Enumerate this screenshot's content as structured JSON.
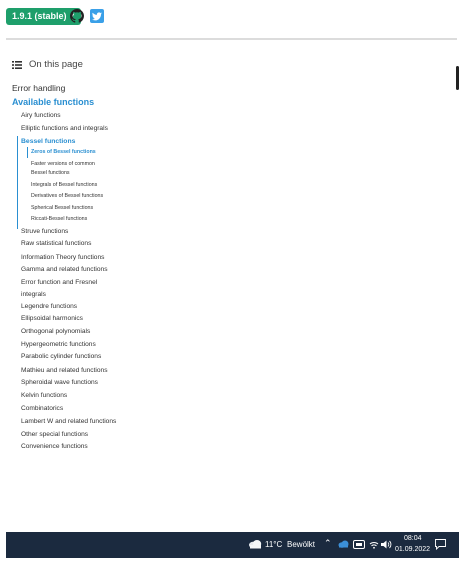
{
  "header": {
    "version_label": "1.9.1 (stable)",
    "github_icon": "github-icon",
    "twitter_icon": "twitter-icon"
  },
  "sidebar": {
    "on_this_page": "On this page",
    "items": [
      {
        "label": "Error handling",
        "level": 0
      },
      {
        "label": "Available functions",
        "level": 0,
        "active": true
      },
      {
        "label": "Airy functions",
        "level": 1
      },
      {
        "label": "Elliptic functions and integrals",
        "level": 1
      },
      {
        "label": "Bessel functions",
        "level": 1,
        "active": true
      },
      {
        "label": "Zeros of Bessel functions",
        "level": 2,
        "active": true
      },
      {
        "label": "Faster versions of common",
        "level": 2
      },
      {
        "label": "Bessel functions",
        "level": 2
      },
      {
        "label": "Integrals of Bessel functions",
        "level": 2
      },
      {
        "label": "Derivatives of Bessel functions",
        "level": 2
      },
      {
        "label": "Spherical Bessel functions",
        "level": 2
      },
      {
        "label": "Riccati-Bessel functions",
        "level": 2
      },
      {
        "label": "Struve functions",
        "level": 1
      },
      {
        "label": "Raw statistical functions",
        "level": 1
      },
      {
        "label": "Information Theory functions",
        "level": 1
      },
      {
        "label": "Gamma and related functions",
        "level": 1
      },
      {
        "label": "Error function and Fresnel",
        "level": 1
      },
      {
        "label": "integrals",
        "level": 1
      },
      {
        "label": "Legendre functions",
        "level": 1
      },
      {
        "label": "Ellipsoidal harmonics",
        "level": 1
      },
      {
        "label": "Orthogonal polynomials",
        "level": 1
      },
      {
        "label": "Hypergeometric functions",
        "level": 1
      },
      {
        "label": "Parabolic cylinder functions",
        "level": 1
      },
      {
        "label": "Mathieu and related functions",
        "level": 1
      },
      {
        "label": "Spheroidal wave functions",
        "level": 1
      },
      {
        "label": "Kelvin functions",
        "level": 1
      },
      {
        "label": "Combinatorics",
        "level": 1
      },
      {
        "label": "Lambert W and related functions",
        "level": 1
      },
      {
        "label": "Other special functions",
        "level": 1
      },
      {
        "label": "Convenience functions",
        "level": 1
      }
    ]
  },
  "taskbar": {
    "temperature": "11°C",
    "condition": "Bewölkt",
    "time": "08:04",
    "date": "01.09.2022"
  }
}
